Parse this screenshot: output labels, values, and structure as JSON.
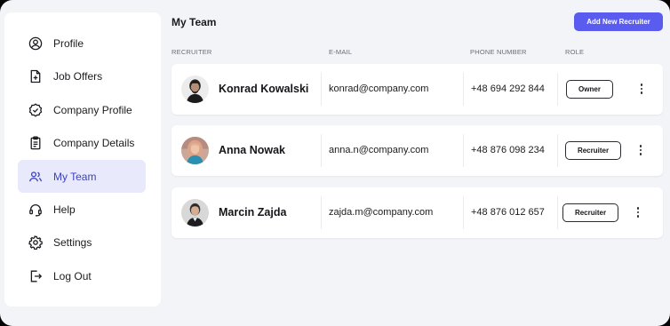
{
  "sidebar": {
    "items": [
      {
        "label": "Profile",
        "icon": "user-circle-icon"
      },
      {
        "label": "Job Offers",
        "icon": "file-plus-icon"
      },
      {
        "label": "Company Profile",
        "icon": "badge-check-icon"
      },
      {
        "label": "Company Details",
        "icon": "clipboard-icon"
      },
      {
        "label": "My Team",
        "icon": "users-icon",
        "active": true
      },
      {
        "label": "Help",
        "icon": "headset-icon"
      },
      {
        "label": "Settings",
        "icon": "gear-icon"
      },
      {
        "label": "Log Out",
        "icon": "logout-icon"
      }
    ]
  },
  "main": {
    "title": "My Team",
    "add_button": "Add New Recruiter",
    "columns": [
      "RECRUITER",
      "E-MAIL",
      "PHONE NUMBER",
      "ROLE"
    ],
    "rows": [
      {
        "name": "Konrad Kowalski",
        "email": "konrad@company.com",
        "phone": "+48 694 292 844",
        "role": "Owner"
      },
      {
        "name": "Anna Nowak",
        "email": "anna.n@company.com",
        "phone": "+48 876 098 234",
        "role": "Recruiter"
      },
      {
        "name": "Marcin Zajda",
        "email": "zajda.m@company.com",
        "phone": "+48 876 012 657",
        "role": "Recruiter"
      }
    ]
  },
  "colors": {
    "accent": "#5a5cf0",
    "active_nav_bg": "#e8eafb",
    "active_nav_text": "#3b3fc4",
    "page_bg": "#f3f4f8"
  }
}
